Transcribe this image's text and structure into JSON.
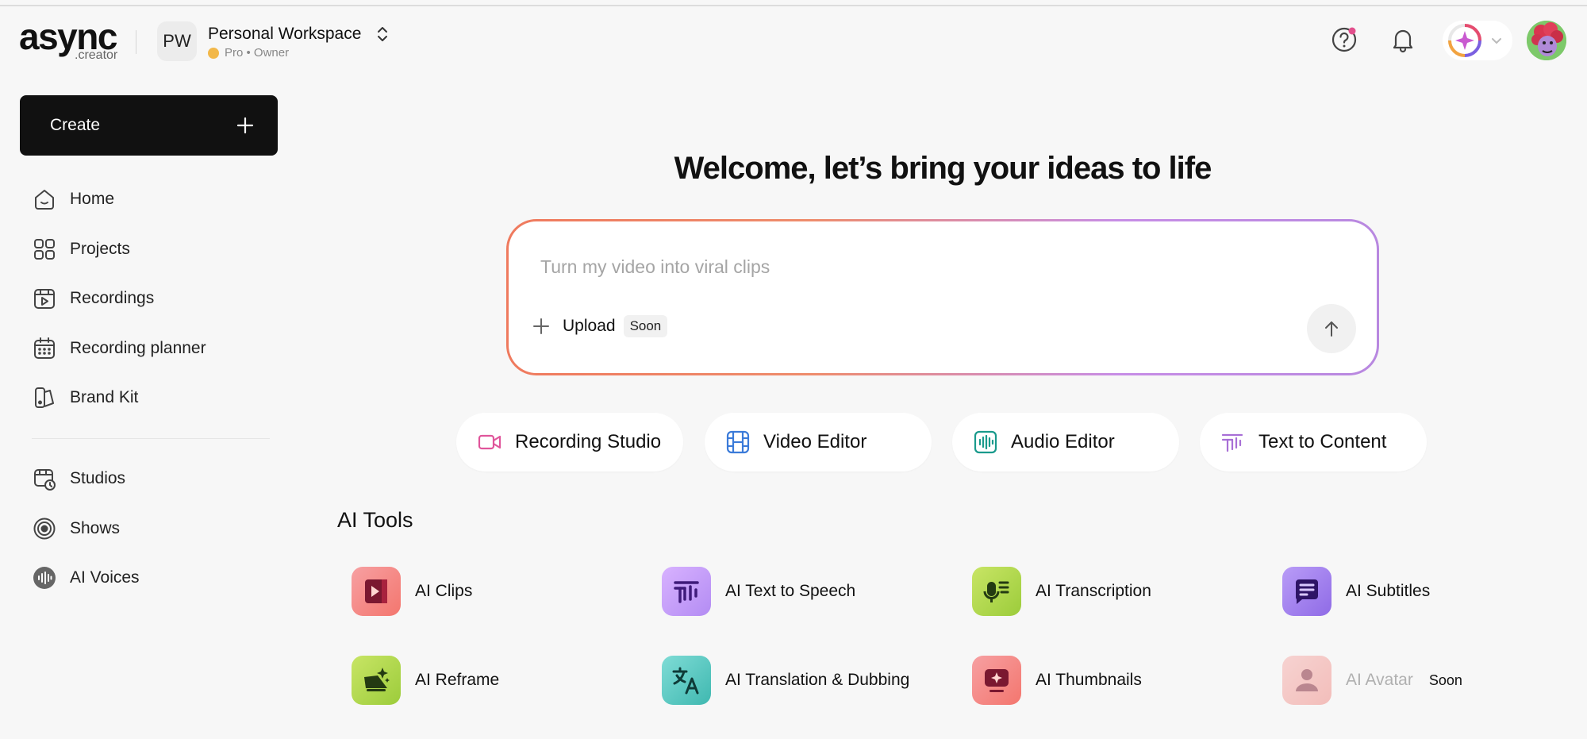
{
  "header": {
    "logo_main": "async",
    "logo_sub": ".creator",
    "workspace_initials": "PW",
    "workspace_name": "Personal Workspace",
    "workspace_plan": "Pro • Owner"
  },
  "sidebar": {
    "create_label": "Create",
    "items": [
      {
        "label": "Home"
      },
      {
        "label": "Projects"
      },
      {
        "label": "Recordings"
      },
      {
        "label": "Recording planner"
      },
      {
        "label": "Brand Kit"
      },
      {
        "label": "Studios"
      },
      {
        "label": "Shows"
      },
      {
        "label": "AI Voices"
      }
    ]
  },
  "main": {
    "welcome": "Welcome, let’s bring your ideas to life",
    "prompt_placeholder": "Turn my video into viral clips",
    "upload_label": "Upload",
    "upload_badge": "Soon",
    "quick_actions": [
      {
        "label": "Recording Studio",
        "icon": "video-camera-icon",
        "color": "#e0559b"
      },
      {
        "label": "Video Editor",
        "icon": "film-icon",
        "color": "#3b7bd9"
      },
      {
        "label": "Audio Editor",
        "icon": "waveform-icon",
        "color": "#1a9a8c"
      },
      {
        "label": "Text to Content",
        "icon": "text-waves-icon",
        "color": "#a86fd6"
      }
    ],
    "tools_title": "AI Tools",
    "tools": [
      {
        "label": "AI Clips",
        "icon": "clips-icon"
      },
      {
        "label": "AI Text to Speech",
        "icon": "speech-icon"
      },
      {
        "label": "AI Transcription",
        "icon": "microphone-icon"
      },
      {
        "label": "AI Subtitles",
        "icon": "subtitles-icon"
      },
      {
        "label": "AI Reframe",
        "icon": "reframe-icon"
      },
      {
        "label": "AI Translation & Dubbing",
        "icon": "translate-icon"
      },
      {
        "label": "AI Thumbnails",
        "icon": "thumbnail-icon"
      },
      {
        "label": "AI Avatar",
        "icon": "avatar-icon",
        "badge": "Soon"
      }
    ]
  }
}
